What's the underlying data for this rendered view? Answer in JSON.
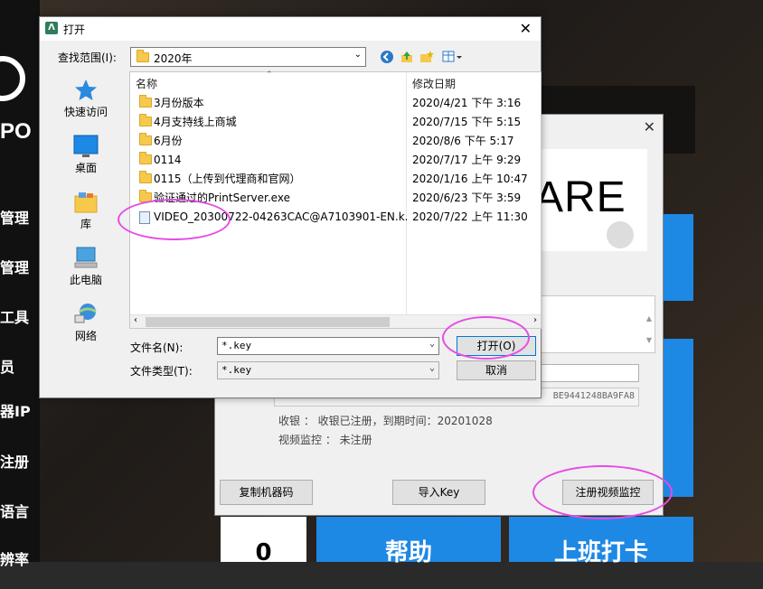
{
  "background_app": {
    "logo_text": "PO",
    "menu": [
      "管理",
      "管理",
      "工具",
      "员",
      "器IP",
      "注册",
      "语言",
      "辨率"
    ],
    "tiles": {
      "count": "0",
      "help": "帮助",
      "clock_in": "上班打卡"
    }
  },
  "register_dialog": {
    "logo_text": "ARE",
    "close_glyph": "✕",
    "machine_code": "BE9441248BA9FA8",
    "status_cashier": "收银 ： 收银已注册，到期时间：20201028",
    "status_video": "视频监控 ： 未注册",
    "buttons": {
      "copy_code": "复制机器码",
      "import_key": "导入Key",
      "register_video": "注册视频监控"
    }
  },
  "open_dialog": {
    "title": "打开",
    "title_icon": "Ʌ",
    "close_glyph": "✕",
    "look_in_label": "查找范围(I):",
    "look_in_value": "2020年",
    "places": [
      {
        "label": "快速访问",
        "icon": "star-icon"
      },
      {
        "label": "桌面",
        "icon": "desktop-icon"
      },
      {
        "label": "库",
        "icon": "library-icon"
      },
      {
        "label": "此电脑",
        "icon": "computer-icon"
      },
      {
        "label": "网络",
        "icon": "network-icon"
      }
    ],
    "columns": {
      "name": "名称",
      "modified": "修改日期"
    },
    "files": [
      {
        "name": "3月份版本",
        "date": "2020/4/21 下午 3:16",
        "type": "folder"
      },
      {
        "name": "4月支持线上商城",
        "date": "2020/7/15 下午 5:15",
        "type": "folder"
      },
      {
        "name": "6月份",
        "date": "2020/8/6 下午 5:17",
        "type": "folder"
      },
      {
        "name": "0114",
        "date": "2020/7/17 上午 9:29",
        "type": "folder"
      },
      {
        "name": "0115（上传到代理商和官网）",
        "date": "2020/1/16 上午 10:47",
        "type": "folder"
      },
      {
        "name": "验证通过的PrintServer.exe",
        "date": "2020/6/23 下午 3:59",
        "type": "folder"
      },
      {
        "name": "VIDEO_20300722-04263CAC@A7103901-EN.k...",
        "date": "2020/7/22 上午 11:30",
        "type": "file"
      }
    ],
    "filename_label": "文件名(N):",
    "filename_value": "*.key",
    "filetype_label": "文件类型(T):",
    "filetype_value": "*.key",
    "open_button": "打开(O)",
    "cancel_button": "取消"
  },
  "colors": {
    "highlight_circle": "#e64ce6",
    "tile_blue": "#1e88e5"
  }
}
